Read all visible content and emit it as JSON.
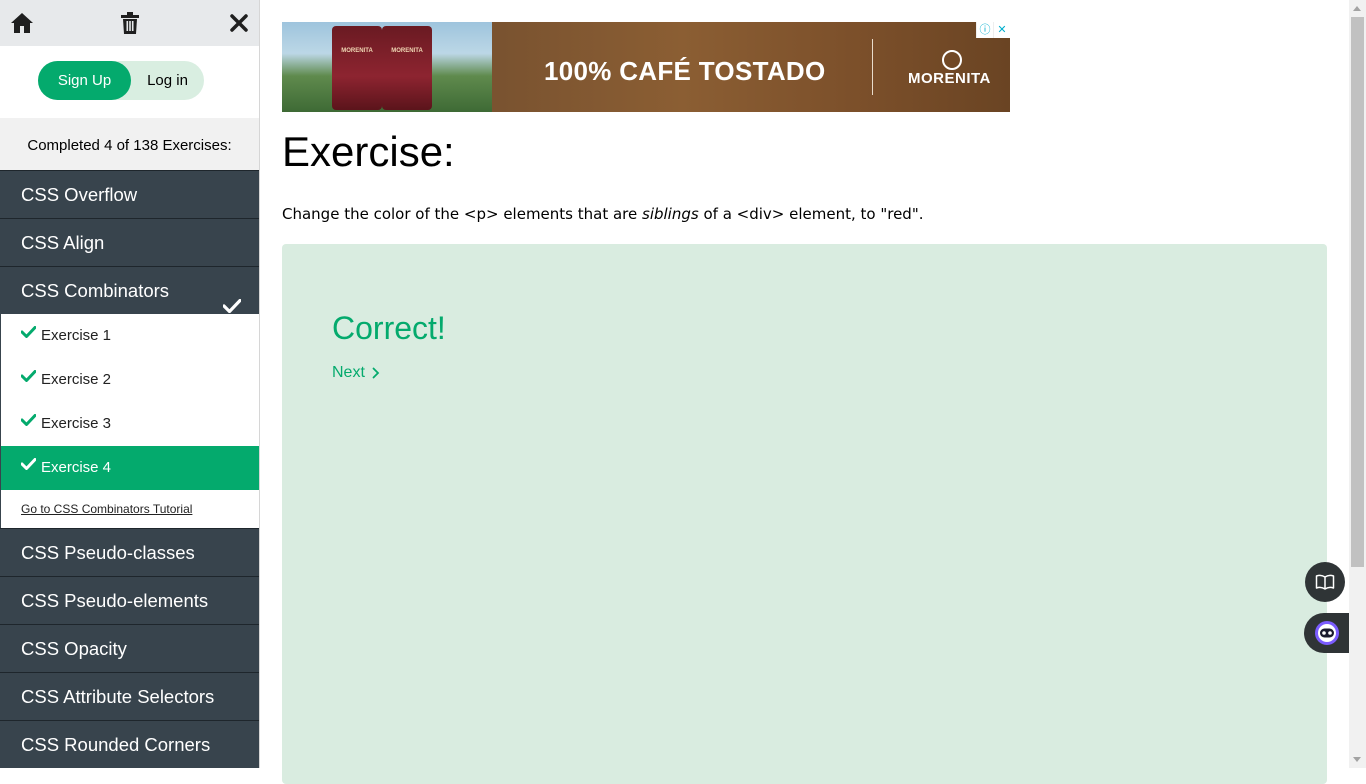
{
  "sidebar": {
    "signup_label": "Sign Up",
    "login_label": "Log in",
    "progress_text": "Completed 4 of 138 Exercises:",
    "categories_before": [
      {
        "label": "CSS Overflow"
      },
      {
        "label": "CSS Align"
      }
    ],
    "active_category": {
      "label": "CSS Combinators",
      "completed": true
    },
    "exercises": [
      {
        "label": "Exercise 1",
        "completed": true
      },
      {
        "label": "Exercise 2",
        "completed": true
      },
      {
        "label": "Exercise 3",
        "completed": true
      },
      {
        "label": "Exercise 4",
        "completed": true,
        "active": true
      }
    ],
    "tutorial_link": "Go to CSS Combinators Tutorial",
    "categories_after": [
      {
        "label": "CSS Pseudo-classes"
      },
      {
        "label": "CSS Pseudo-elements"
      },
      {
        "label": "CSS Opacity"
      },
      {
        "label": "CSS Attribute Selectors"
      },
      {
        "label": "CSS Rounded Corners"
      }
    ]
  },
  "ad": {
    "headline": "100% CAFÉ TOSTADO",
    "brand": "MORENITA",
    "bag_label": "MORENITA"
  },
  "main": {
    "heading": "Exercise:",
    "instruction": {
      "part1": "Change the color of the <p> elements that are ",
      "emphasis": "siblings",
      "part2": " of a <div> element, to \"red\"."
    },
    "result": {
      "title": "Correct!",
      "next_label": "Next"
    }
  },
  "colors": {
    "accent": "#04aa6d",
    "sidebar_dark": "#38444d",
    "result_bg": "#d9ece0"
  }
}
